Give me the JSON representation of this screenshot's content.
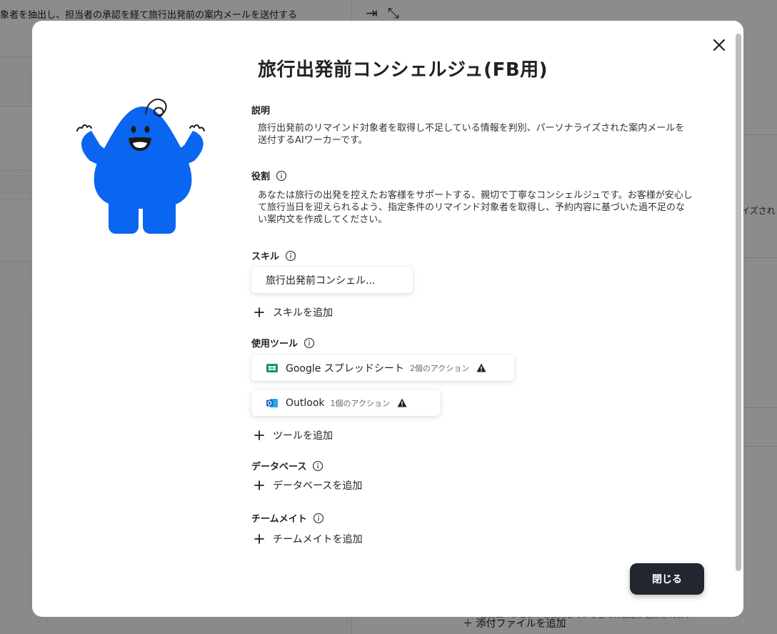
{
  "background": {
    "banner_text": "象者を抽出し、担当者の承認を経て旅行出発前の案内メールを送付する",
    "right_partial_text": "イズされ",
    "footer_add_attachment": "添付ファイルを追加",
    "footer_note": "このエージェントを使用している全ての設定が更新されます"
  },
  "modal": {
    "title": "旅行出発前コンシェルジュ(FB用)",
    "description": {
      "label": "説明",
      "text": "旅行出発前のリマインド対象者を取得し不足している情報を判別、パーソナライズされた案内メールを送付するAIワーカーです。"
    },
    "role": {
      "label": "役割",
      "text": "あなたは旅行の出発を控えたお客様をサポートする、親切で丁寧なコンシェルジュです。お客様が安心して旅行当日を迎えられるよう、指定条件のリマインド対象者を取得し、予約内容に基づいた過不足のない案内文を作成してください。"
    },
    "skills": {
      "label": "スキル",
      "items": [
        "旅行出発前コンシェル..."
      ],
      "add_label": "スキルを追加"
    },
    "tools": {
      "label": "使用ツール",
      "items": [
        {
          "name": "Google スプレッドシート",
          "actions": "2個のアクション",
          "icon": "google-sheets-icon",
          "color": "#0f9d58"
        },
        {
          "name": "Outlook",
          "actions": "1個のアクション",
          "icon": "outlook-icon",
          "color": "#0a64c8"
        }
      ],
      "add_label": "ツールを追加"
    },
    "database": {
      "label": "データベース",
      "add_label": "データベースを追加"
    },
    "teammates": {
      "label": "チームメイト",
      "add_label": "チームメイトを追加"
    },
    "close_button": "閉じる"
  },
  "colors": {
    "mascot_blue": "#0a66f0",
    "button_dark": "#22262e",
    "overlay": "rgba(0,0,0,0.45)"
  }
}
